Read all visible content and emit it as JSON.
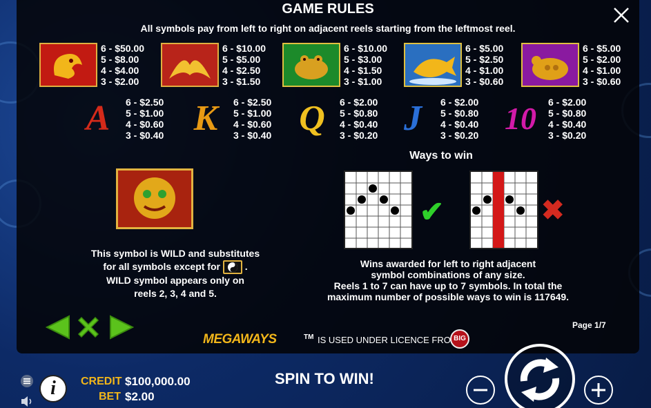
{
  "rules": {
    "title": "GAME RULES",
    "subtitle": "All symbols pay from left to right on adjacent reels starting from the leftmost reel.",
    "page": "Page 1/7"
  },
  "high_symbols": [
    {
      "name": "dragon",
      "color": "#c21a12",
      "border": "#e0b040",
      "pays": [
        "6 - $50.00",
        "5 - $8.00",
        "4 - $4.00",
        "3 - $2.00"
      ]
    },
    {
      "name": "phoenix",
      "color": "#b8241a",
      "border": "#e0b040",
      "pays": [
        "6 - $10.00",
        "5 - $5.00",
        "4 - $2.50",
        "3 - $1.50"
      ]
    },
    {
      "name": "frog",
      "color": "#1c8a2a",
      "border": "#e0c040",
      "pays": [
        "6 - $10.00",
        "5 - $3.00",
        "4 - $1.50",
        "3 - $1.00"
      ]
    },
    {
      "name": "koi-fish",
      "color": "#2a6fc0",
      "border": "#e0c040",
      "pays": [
        "6 - $5.00",
        "5 - $2.50",
        "4 - $1.00",
        "3 - $0.60"
      ]
    },
    {
      "name": "turtle",
      "color": "#8a1aa0",
      "border": "#e0c040",
      "pays": [
        "6 - $5.00",
        "5 - $2.00",
        "4 - $1.00",
        "3 - $0.60"
      ]
    }
  ],
  "low_symbols": [
    {
      "name": "A",
      "color": "#d42a1a",
      "pays": [
        "6 - $2.50",
        "5 - $1.00",
        "4 - $0.60",
        "3 - $0.40"
      ]
    },
    {
      "name": "K",
      "color": "#e89a14",
      "pays": [
        "6 - $2.50",
        "5 - $1.00",
        "4 - $0.60",
        "3 - $0.40"
      ]
    },
    {
      "name": "Q",
      "color": "#f0c020",
      "pays": [
        "6 - $2.00",
        "5 - $0.80",
        "4 - $0.40",
        "3 - $0.20"
      ]
    },
    {
      "name": "J",
      "color": "#2a6fd8",
      "pays": [
        "6 - $2.00",
        "5 - $0.80",
        "4 - $0.40",
        "3 - $0.20"
      ]
    },
    {
      "name": "10",
      "color": "#d21aa8",
      "pays": [
        "6 - $2.00",
        "5 - $0.80",
        "4 - $0.40",
        "3 - $0.20"
      ]
    }
  ],
  "wild": {
    "line1": "This symbol is WILD and substitutes",
    "line2a": "for all symbols except for",
    "line2b": ".",
    "line3": "WILD symbol appears only on",
    "line4": "reels 2, 3, 4 and 5."
  },
  "ways": {
    "title": "Ways to win",
    "line1": "Wins awarded for left to right adjacent",
    "line2": "symbol combinations of any size.",
    "line3": "Reels 1 to 7 can have up to 7 symbols. In total the",
    "line4": "maximum number of possible ways to win is 117649.",
    "valid_mark": "✔",
    "invalid_mark": "✖"
  },
  "licence": {
    "logo": "MEGAWAYS",
    "tm": "TM",
    "text": "IS USED UNDER LICENCE FROM",
    "big": "BIG"
  },
  "bottom": {
    "credit_label": "CREDIT",
    "credit_value": "$100,000.00",
    "bet_label": "BET",
    "bet_value": "$2.00",
    "spin_text": "SPIN TO WIN!"
  },
  "colors": {
    "accent_gold": "#f2b61a",
    "nav_green": "#5bc21c",
    "check_green": "#2fd02a",
    "cross_red": "#d42a20"
  }
}
